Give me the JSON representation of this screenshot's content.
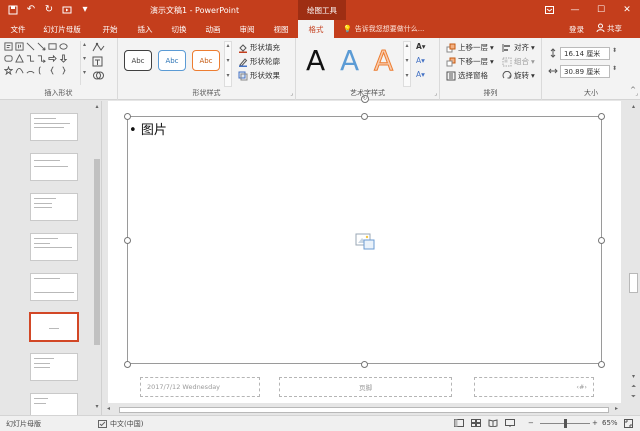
{
  "window": {
    "title": "演示文稿1 - PowerPoint",
    "context_tab": "绘图工具"
  },
  "quick_access": [
    "save",
    "undo",
    "redo",
    "present-from-start",
    "customize"
  ],
  "tabs": [
    {
      "label": "文件"
    },
    {
      "label": "幻灯片母版"
    },
    {
      "label": "开始"
    },
    {
      "label": "插入"
    },
    {
      "label": "切换"
    },
    {
      "label": "动画"
    },
    {
      "label": "审阅"
    },
    {
      "label": "视图"
    },
    {
      "label": "格式",
      "active": true
    }
  ],
  "tell_me": "告诉我您想要做什么...",
  "signin": "登录",
  "share": "共享",
  "ribbon": {
    "insert_shapes": {
      "label": "插入形状"
    },
    "shape_styles": {
      "label": "形状样式",
      "gallery": [
        "Abc",
        "Abc",
        "Abc"
      ],
      "gallery_colors": [
        "#404040",
        "#5b9bd5",
        "#ed7d31"
      ],
      "fill": "形状填充",
      "outline": "形状轮廓",
      "effects": "形状效果"
    },
    "wordart": {
      "label": "艺术字样式",
      "letters": [
        "A",
        "A",
        "A"
      ]
    },
    "arrange": {
      "label": "排列",
      "bring_forward": "上移一层",
      "send_backward": "下移一层",
      "selection_pane": "选择窗格",
      "align": "对齐",
      "group": "组合",
      "rotate": "旋转"
    },
    "size": {
      "label": "大小",
      "height": "16.14 厘米",
      "width": "30.89 厘米"
    }
  },
  "slide": {
    "placeholder_text": "图片",
    "footer_date": "2017/7/12 Wednesday",
    "footer_center": "页脚",
    "footer_number": "‹#›"
  },
  "status": {
    "view": "幻灯片母版",
    "language": "中文(中国)",
    "zoom": "65%"
  },
  "colors": {
    "accent": "#c43e1c",
    "selected_thumb": "#d24726"
  }
}
